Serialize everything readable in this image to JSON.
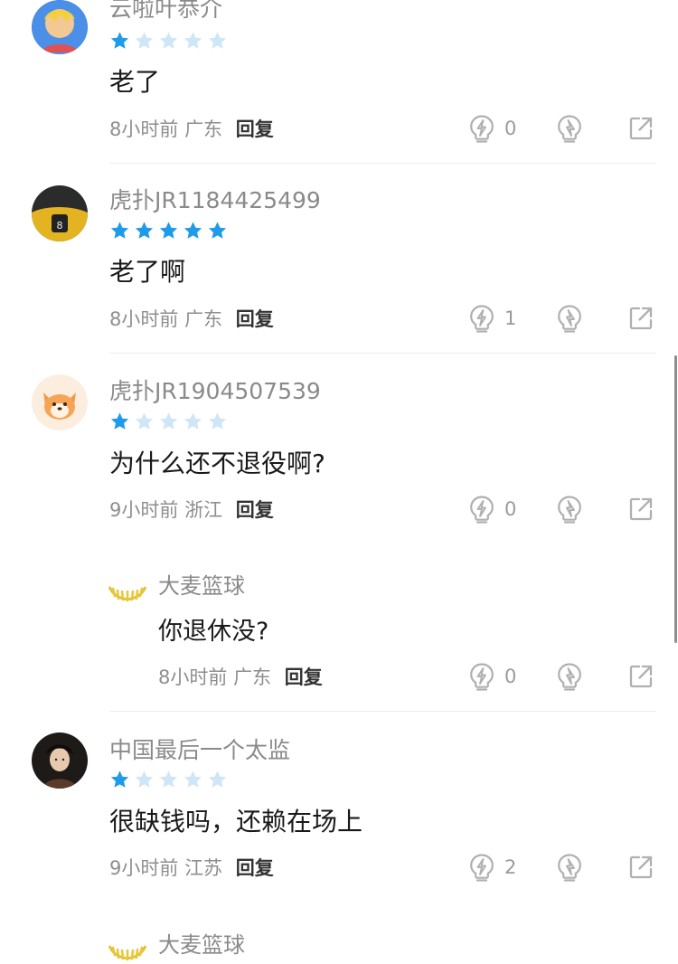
{
  "comments": [
    {
      "username": "云啦叶恭介",
      "rating": 1,
      "content": "老了",
      "time": "8小时前",
      "location": "广东",
      "reply_label": "回复",
      "likes": "0"
    },
    {
      "username": "虎扑JR1184425499",
      "rating": 5,
      "content": "老了啊",
      "time": "8小时前",
      "location": "广东",
      "reply_label": "回复",
      "likes": "1"
    },
    {
      "username": "虎扑JR1904507539",
      "rating": 1,
      "content": "为什么还不退役啊?",
      "time": "9小时前",
      "location": "浙江",
      "reply_label": "回复",
      "likes": "0",
      "reply": {
        "username": "大麦篮球",
        "content": "你退休没?",
        "time": "8小时前",
        "location": "广东",
        "reply_label": "回复",
        "likes": "0"
      }
    },
    {
      "username": "中国最后一个太监",
      "rating": 1,
      "content": "很缺钱吗，还赖在场上",
      "time": "9小时前",
      "location": "江苏",
      "reply_label": "回复",
      "likes": "2",
      "reply": {
        "username": "大麦篮球"
      }
    }
  ],
  "colors": {
    "star_filled": "#1e9be9",
    "star_empty": "#cfe6f7",
    "icon": "#b0b0b0"
  },
  "icons": [
    "like-lightning-icon",
    "dislike-lightning-icon",
    "share-icon",
    "star-icon"
  ]
}
